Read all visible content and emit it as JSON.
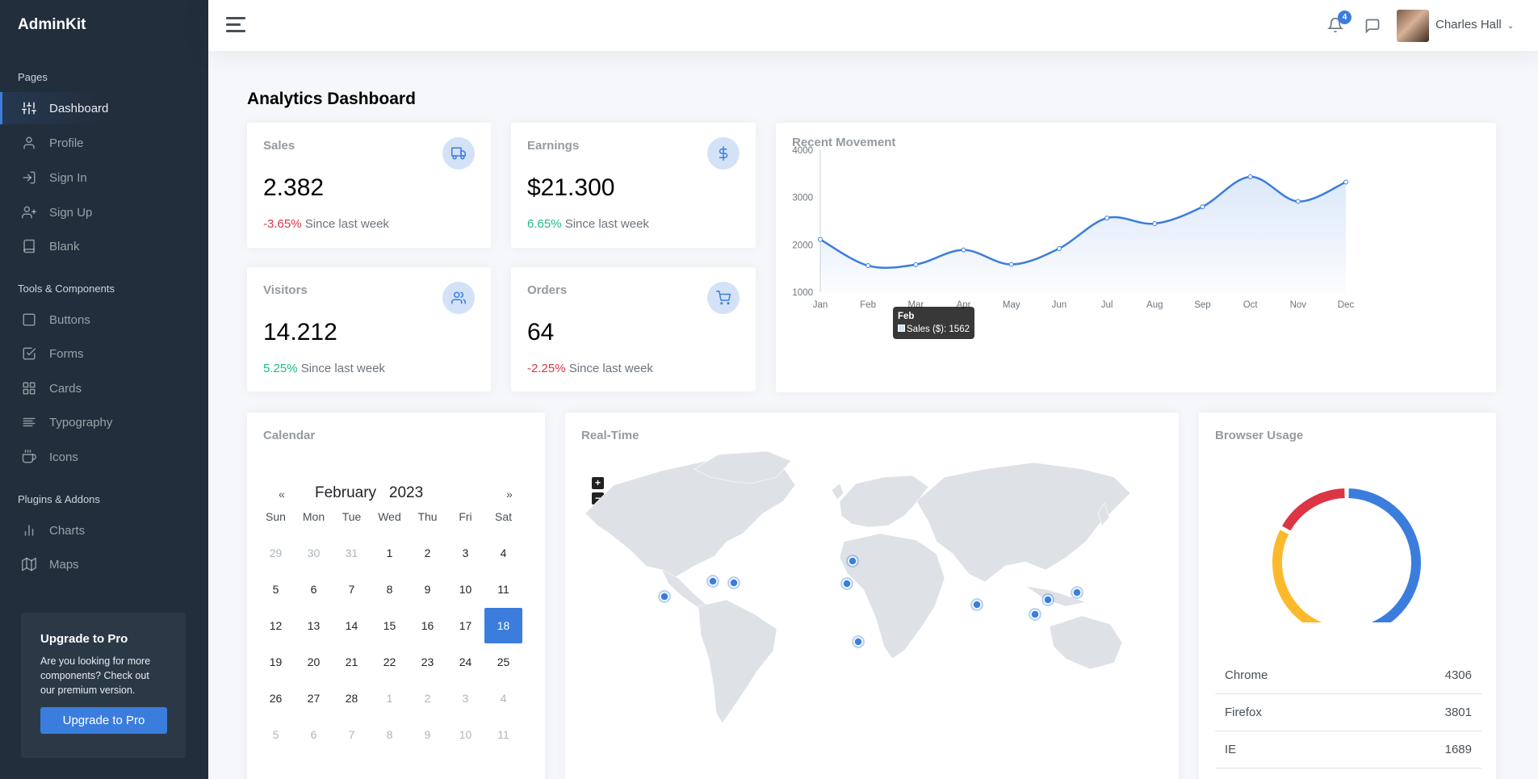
{
  "brand": "AdminKit",
  "sidebar": {
    "sections": [
      "Pages",
      "Tools & Components",
      "Plugins & Addons"
    ],
    "items": [
      {
        "label": "Dashboard",
        "icon": "sliders-icon"
      },
      {
        "label": "Profile",
        "icon": "user-icon"
      },
      {
        "label": "Sign In",
        "icon": "log-in-icon"
      },
      {
        "label": "Sign Up",
        "icon": "user-plus-icon"
      },
      {
        "label": "Blank",
        "icon": "book-icon"
      },
      {
        "label": "Buttons",
        "icon": "square-icon"
      },
      {
        "label": "Forms",
        "icon": "check-square-icon"
      },
      {
        "label": "Cards",
        "icon": "grid-icon"
      },
      {
        "label": "Typography",
        "icon": "align-left-icon"
      },
      {
        "label": "Icons",
        "icon": "coffee-icon"
      },
      {
        "label": "Charts",
        "icon": "bar-chart-icon"
      },
      {
        "label": "Maps",
        "icon": "map-icon"
      }
    ],
    "cta": {
      "title": "Upgrade to Pro",
      "text": "Are you looking for more components? Check out our premium version.",
      "button": "Upgrade to Pro"
    }
  },
  "topbar": {
    "notifications": "4",
    "user": "Charles Hall"
  },
  "page": {
    "title_bold": "Analytics",
    "title_rest": " Dashboard"
  },
  "stats": [
    {
      "title": "Sales",
      "value": "2.382",
      "change": "-3.65%",
      "since": "Since last week",
      "icon": "truck-icon"
    },
    {
      "title": "Earnings",
      "value": "$21.300",
      "change": "6.65%",
      "since": "Since last week",
      "icon": "dollar-icon"
    },
    {
      "title": "Visitors",
      "value": "14.212",
      "change": "5.25%",
      "since": "Since last week",
      "icon": "users-icon"
    },
    {
      "title": "Orders",
      "value": "64",
      "change": "-2.25%",
      "since": "Since last week",
      "icon": "shopping-cart-icon"
    }
  ],
  "recent_movement": {
    "title": "Recent Movement",
    "tooltip_title": "Feb",
    "tooltip_text": "Sales ($): 1562"
  },
  "chart_data": {
    "type": "area",
    "title": "Recent Movement",
    "categories": [
      "Jan",
      "Feb",
      "Mar",
      "Apr",
      "May",
      "Jun",
      "Jul",
      "Aug",
      "Sep",
      "Oct",
      "Nov",
      "Dec"
    ],
    "series": [
      {
        "name": "Sales ($)",
        "values": [
          2115,
          1562,
          1584,
          1892,
          1587,
          1923,
          2566,
          2448,
          2805,
          3438,
          2917,
          3327
        ]
      }
    ],
    "yticks": [
      1000,
      2000,
      3000,
      4000
    ],
    "ylim": [
      1000,
      4000
    ],
    "grid": false,
    "color": "#3b7ddd"
  },
  "calendar": {
    "title": "Calendar",
    "prev": "«",
    "next": "»",
    "month": "February",
    "year": "2023",
    "dow": [
      "Sun",
      "Mon",
      "Tue",
      "Wed",
      "Thu",
      "Fri",
      "Sat"
    ],
    "weeks": [
      [
        "29",
        "30",
        "31",
        "1",
        "2",
        "3",
        "4"
      ],
      [
        "5",
        "6",
        "7",
        "8",
        "9",
        "10",
        "11"
      ],
      [
        "12",
        "13",
        "14",
        "15",
        "16",
        "17",
        "18"
      ],
      [
        "19",
        "20",
        "21",
        "22",
        "23",
        "24",
        "25"
      ],
      [
        "26",
        "27",
        "28",
        "1",
        "2",
        "3",
        "4"
      ],
      [
        "5",
        "6",
        "7",
        "8",
        "9",
        "10",
        "11"
      ]
    ],
    "selected": "18"
  },
  "realtime": {
    "title": "Real-Time",
    "zoom_in": "+",
    "zoom_out": "−"
  },
  "browser_usage": {
    "title": "Browser Usage",
    "rows": [
      {
        "name": "Chrome",
        "value": "4306"
      },
      {
        "name": "Firefox",
        "value": "3801"
      },
      {
        "name": "IE",
        "value": "1689"
      }
    ],
    "colors": [
      "#3b7ddd",
      "#fcb92c",
      "#dc3545"
    ]
  }
}
